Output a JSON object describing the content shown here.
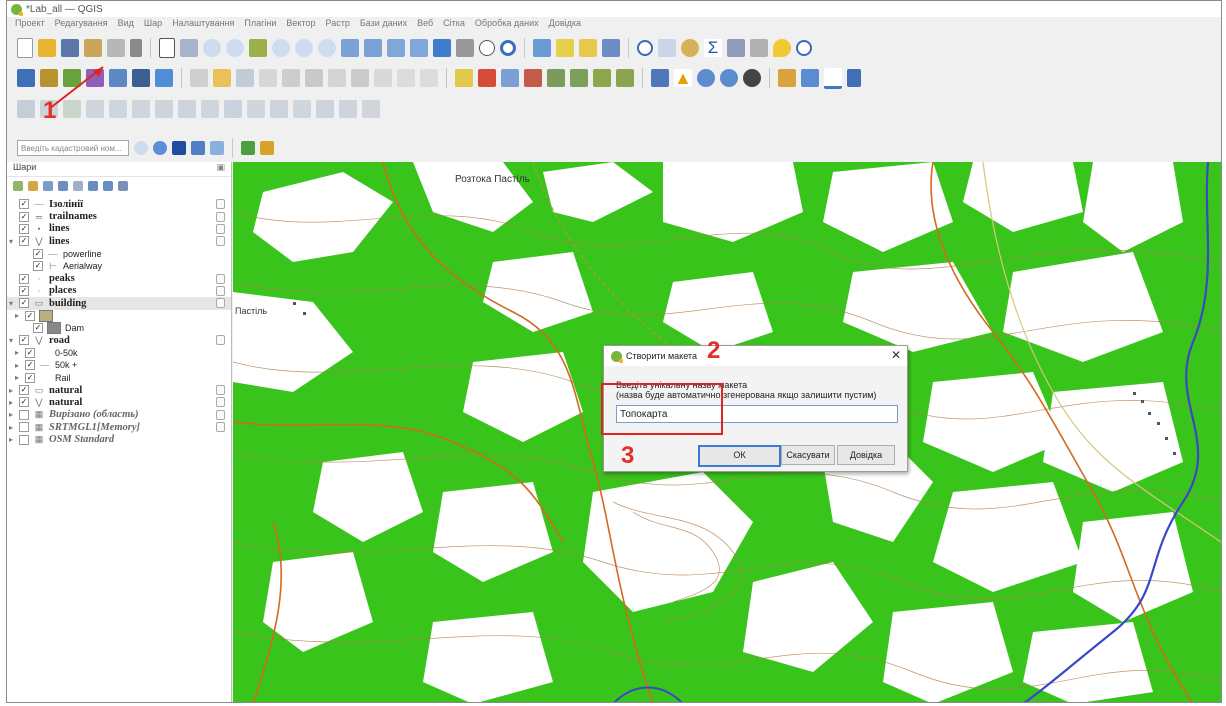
{
  "window": {
    "title": "*Lab_all — QGIS"
  },
  "menu": [
    "Проект",
    "Редагування",
    "Вид",
    "Шар",
    "Налаштування",
    "Плагіни",
    "Вектор",
    "Растр",
    "Бази даних",
    "Веб",
    "Сітка",
    "Обробка даних",
    "Довідка"
  ],
  "cadastral_search": {
    "placeholder": "Введіть кадастровий ном..."
  },
  "layers_panel": {
    "title": "Шари",
    "rows": [
      {
        "label": "Ізолінії",
        "style": "b"
      },
      {
        "label": "trailnames",
        "style": "b"
      },
      {
        "label": "lines",
        "style": "b"
      },
      {
        "label": "lines",
        "style": "b"
      },
      {
        "label": "powerline",
        "style": "n"
      },
      {
        "label": "Aerialway",
        "style": "n"
      },
      {
        "label": "peaks",
        "style": "b"
      },
      {
        "label": "places",
        "style": "b"
      },
      {
        "label": "building",
        "style": "b"
      },
      {
        "label": "",
        "style": "n"
      },
      {
        "label": "Dam",
        "style": "n"
      },
      {
        "label": "road",
        "style": "b"
      },
      {
        "label": "0-50k",
        "style": "n"
      },
      {
        "label": "50k +",
        "style": "n"
      },
      {
        "label": "Rail",
        "style": "n"
      },
      {
        "label": "natural",
        "style": "b"
      },
      {
        "label": "natural",
        "style": "b"
      },
      {
        "label": "Вирізано (область)",
        "style": "i"
      },
      {
        "label": "SRTMGL1[Memory]",
        "style": "i"
      },
      {
        "label": "OSM Standard",
        "style": "i"
      }
    ]
  },
  "map": {
    "place_label_1": "Розтока Пастіль",
    "place_label_2": "Пастіль"
  },
  "dialog": {
    "title": "Створити макета",
    "prompt_line1": "Введіть унікальну назву макета",
    "prompt_line2": "(назва буде автоматично згенерована якщо залишити пустим)",
    "input_value": "Топокарта",
    "ok": "ОК",
    "cancel": "Скасувати",
    "help": "Довідка"
  },
  "annotations": {
    "step1": "1",
    "step2": "2",
    "step3": "3"
  },
  "colors": {
    "forest": "#39c41c",
    "annotation_red": "#e0231f",
    "contour": "#b07a4a",
    "road": "#d2691e",
    "river": "#3a47c8"
  }
}
